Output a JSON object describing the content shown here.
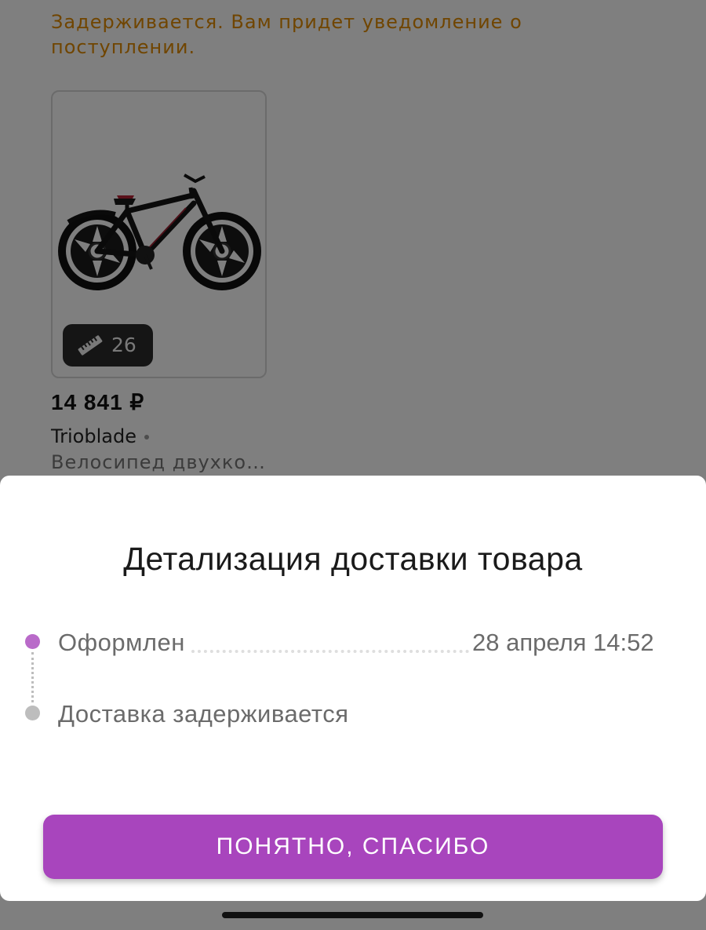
{
  "background": {
    "delay_notice": "Задерживается. Вам придет уведомление о поступлении.",
    "product": {
      "image": "bicycle-photo",
      "size_icon": "ruler-icon",
      "size_value": "26",
      "price": "14 841 ₽",
      "brand": "Trioblade",
      "name": "Велосипед двухко…"
    }
  },
  "sheet": {
    "title": "Детализация доставки товара",
    "steps": [
      {
        "label": "Оформлен",
        "date": "28 апреля 14:52",
        "status_color": "#b96ac9"
      },
      {
        "label": "Доставка задерживается",
        "status_color": "#bdbdbd"
      }
    ],
    "confirm_button": "ПОНЯТНО, СПАСИБО"
  },
  "colors": {
    "accent": "#a845bd",
    "warning": "#e08a00",
    "scrim": "rgba(0,0,0,0.5)"
  }
}
